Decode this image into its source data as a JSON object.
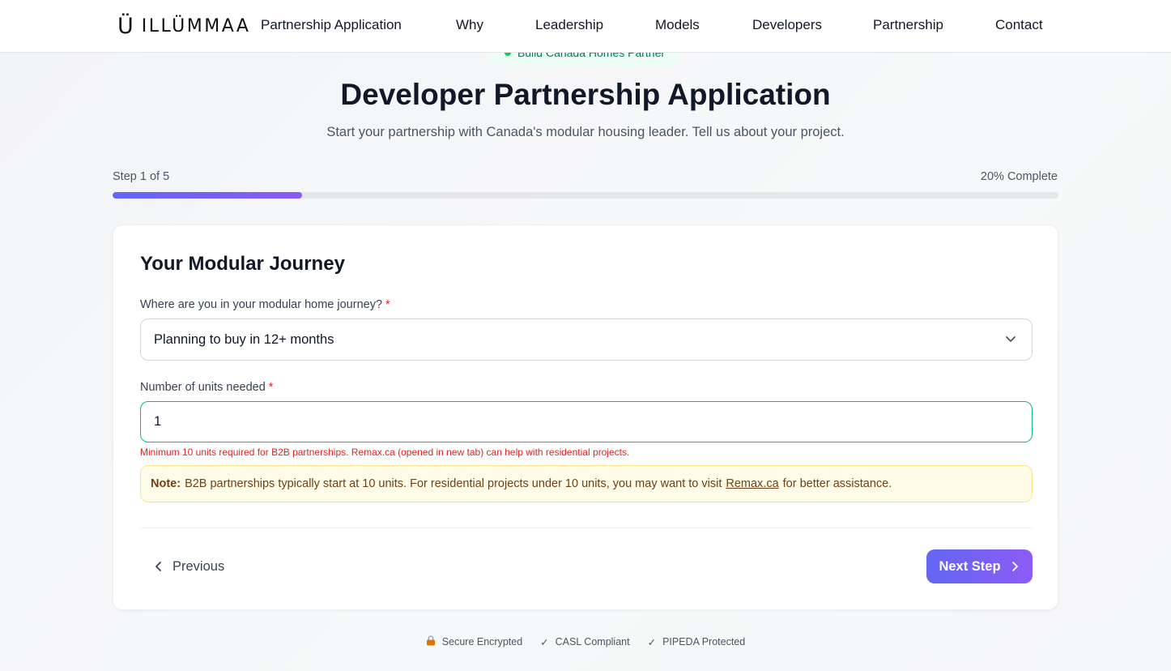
{
  "header": {
    "logo_mark": "Ü",
    "logo_text": "ILLÜMMAA",
    "nav": [
      {
        "label": "Partnership Application"
      },
      {
        "label": "Why"
      },
      {
        "label": "Leadership"
      },
      {
        "label": "Models"
      },
      {
        "label": "Developers"
      },
      {
        "label": "Partnership"
      },
      {
        "label": "Contact"
      }
    ]
  },
  "hero": {
    "badge": "Build Canada Homes Partner",
    "title": "Developer Partnership Application",
    "subtitle": "Start your partnership with Canada's modular housing leader. Tell us about your project."
  },
  "progress": {
    "step_text": "Step 1 of 5",
    "complete_text": "20% Complete",
    "fraction": 0.2
  },
  "form": {
    "title": "Your Modular Journey",
    "journey_label": "Where are you in your modular home journey?",
    "journey_required": "*",
    "journey_value": "Planning to buy in 12+ months",
    "units_label": "Number of units needed",
    "units_required": "*",
    "units_value": "1",
    "error": "Minimum 10 units required for B2B partnerships. Remax.ca (opened in new tab) can help with residential projects.",
    "note_strong": "Note:",
    "note_before": "B2B partnerships typically start at 10 units. For residential projects under 10 units, you may want to visit",
    "note_link": "Remax.ca",
    "note_after": "for better assistance.",
    "prev_label": "Previous",
    "next_label": "Next Step"
  },
  "trust": {
    "secure": "Secure Encrypted",
    "casl": "CASL Compliant",
    "pipeda": "PIPEDA Protected",
    "check": "✓"
  },
  "colors": {
    "accent_start": "#6366f1",
    "accent_end": "#8b5cf6",
    "input_focus": "#10b981",
    "error": "#dc2626",
    "note_bg": "#fefce8"
  }
}
